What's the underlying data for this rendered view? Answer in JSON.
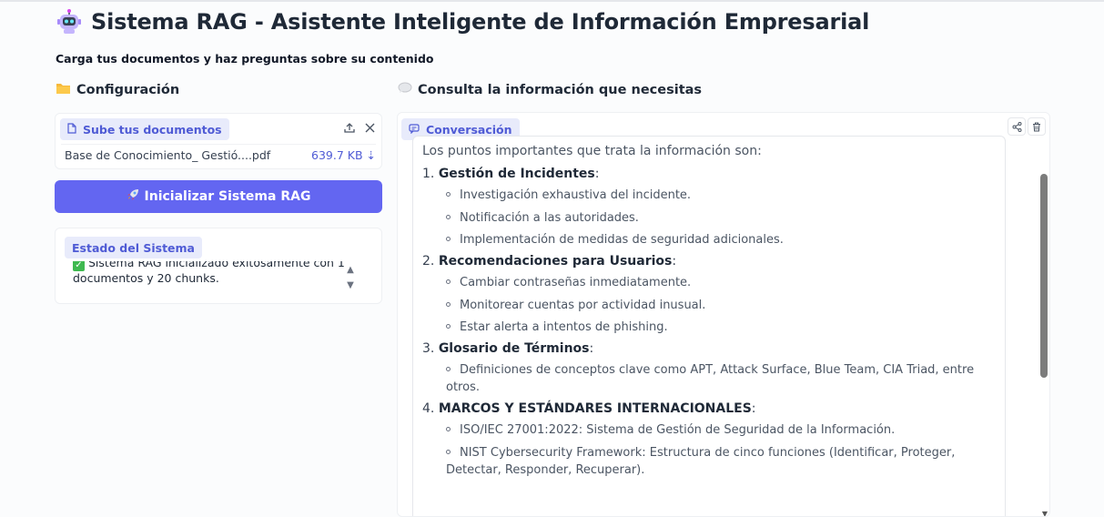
{
  "header": {
    "title": "Sistema RAG - Asistente Inteligente de Información Empresarial",
    "subtitle": "Carga tus documentos y haz preguntas sobre su contenido"
  },
  "config": {
    "heading": "Configuración",
    "upload": {
      "label": "Sube tus documentos",
      "file_name": "Base de Conocimiento_ Gestió....pdf",
      "file_size": "639.7 KB ⇣"
    },
    "init_button": "Inicializar Sistema RAG",
    "status": {
      "label": "Estado del Sistema",
      "text": "Sistema RAG inicializado exitosamente con 1 documentos y 20 chunks."
    }
  },
  "chat": {
    "heading": "Consulta la información que necesitas",
    "label": "Conversación",
    "intro": "Los puntos importantes que trata la información son:",
    "items": [
      {
        "num": "1.",
        "title": "Gestión de Incidentes",
        "bullets": [
          "Investigación exhaustiva del incidente.",
          "Notificación a las autoridades.",
          "Implementación de medidas de seguridad adicionales."
        ]
      },
      {
        "num": "2.",
        "title": "Recomendaciones para Usuarios",
        "bullets": [
          "Cambiar contraseñas inmediatamente.",
          "Monitorear cuentas por actividad inusual.",
          "Estar alerta a intentos de phishing."
        ]
      },
      {
        "num": "3.",
        "title": "Glosario de Términos",
        "bullets": [
          "Definiciones de conceptos clave como APT, Attack Surface, Blue Team, CIA Triad, entre otros."
        ]
      },
      {
        "num": "4.",
        "title": "MARCOS Y ESTÁNDARES INTERNACIONALES",
        "bullets": [
          "ISO/IEC 27001:2022: Sistema de Gestión de Seguridad de la Información.",
          "NIST Cybersecurity Framework: Estructura de cinco funciones (Identificar, Proteger, Detectar, Responder, Recuperar)."
        ]
      }
    ]
  },
  "colors": {
    "accent": "#6366f1",
    "chip_bg": "#e8ebfb",
    "chip_text": "#4f5bd5"
  }
}
